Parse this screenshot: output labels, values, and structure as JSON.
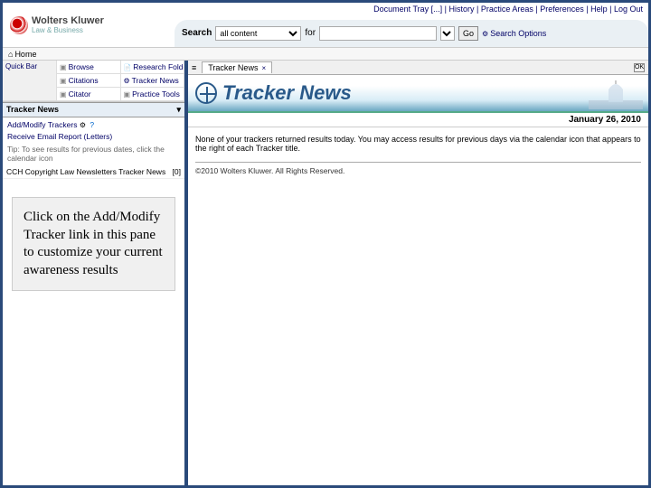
{
  "brand": {
    "name": "Wolters Kluwer",
    "sub": "Law & Business"
  },
  "topLinks": [
    "Document Tray [...]",
    "History",
    "Practice Areas",
    "Preferences",
    "Help",
    "Log Out"
  ],
  "search": {
    "label": "Search",
    "scope": "all content",
    "forLabel": "for",
    "go": "Go",
    "options": "Search Options"
  },
  "home": "Home",
  "leftNav": {
    "quickBar": "Quick Bar",
    "cells": [
      "Browse",
      "Research Folders",
      "Citations",
      "Tracker News",
      "Citator",
      "Practice Tools"
    ]
  },
  "trackerSection": {
    "title": "Tracker News",
    "addModify": "Add/Modify Trackers",
    "receive": "Receive Email Report (Letters)",
    "tip": "Tip: To see results for previous dates, click the calendar icon",
    "item": {
      "label": "CCH Copyright Law Newsletters Tracker News",
      "count": "[0]"
    }
  },
  "callout": "Click on the Add/Modify Tracker link in this pane to customize your current awareness results",
  "tabs": {
    "active": "Tracker News",
    "close": "×",
    "max": "OK"
  },
  "banner": {
    "title": "Tracker News"
  },
  "date": "January 26, 2010",
  "message": "None of your trackers returned results today. You may access results for previous days via the calendar icon that appears to the right of each Tracker title.",
  "copyright": "©2010 Wolters Kluwer. All Rights Reserved."
}
